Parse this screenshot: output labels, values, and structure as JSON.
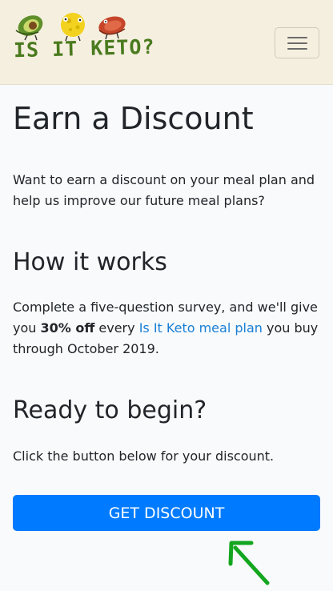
{
  "header": {
    "logo_text": "IS IT KETO?",
    "menu_icon": "hamburger-menu-icon"
  },
  "main": {
    "title": "Earn a Discount",
    "intro": "Want to earn a discount on your meal plan and help us improve our future meal plans?",
    "how_heading": "How it works",
    "how_text": {
      "before": "Complete a five-question survey, and we'll give you ",
      "bold": "30% off",
      "middle": " every ",
      "link": "Is It Keto meal plan",
      "after": " you buy through October 2019."
    },
    "ready_heading": "Ready to begin?",
    "ready_text": "Click the button below for your discount.",
    "cta_label": "GET DISCOUNT"
  },
  "colors": {
    "header_bg": "#f5efdf",
    "brand_green": "#4a7a1e",
    "link": "#1a7fd4",
    "button": "#007bff",
    "arrow": "#14a61f"
  }
}
